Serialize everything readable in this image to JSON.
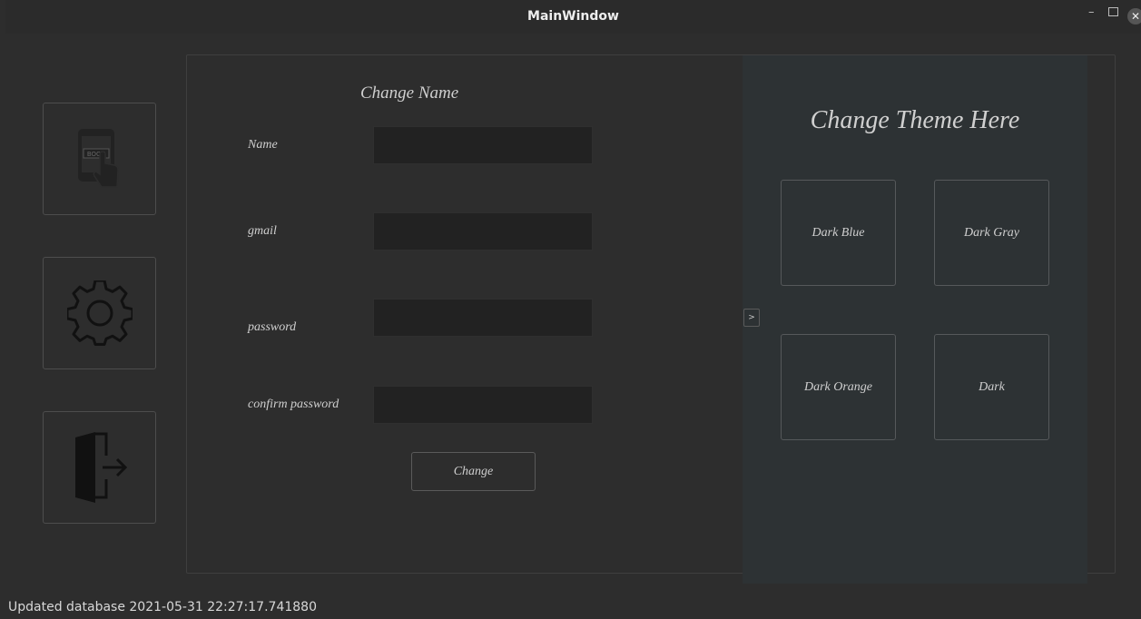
{
  "window": {
    "title": "MainWindow",
    "minimize": "–",
    "close": "✕"
  },
  "sidebar": {
    "items": [
      {
        "name": "book-app-button",
        "icon": "book-phone-icon"
      },
      {
        "name": "settings-button",
        "icon": "gear-icon"
      },
      {
        "name": "logout-button",
        "icon": "exit-door-icon"
      }
    ]
  },
  "form": {
    "title": "Change Name",
    "name_label": "Name",
    "gmail_label": "gmail",
    "password_label": "password",
    "confirm_label": "confirm password",
    "name_value": "",
    "gmail_value": "",
    "password_value": "",
    "confirm_value": "",
    "submit_label": "Change"
  },
  "panel_toggle": ">",
  "theme": {
    "title": "Change Theme Here",
    "options": [
      "Dark Blue",
      "Dark Gray",
      "Dark Orange",
      "Dark"
    ]
  },
  "status_bar": {
    "text": "Updated database 2021-05-31 22:27:17.741880"
  }
}
